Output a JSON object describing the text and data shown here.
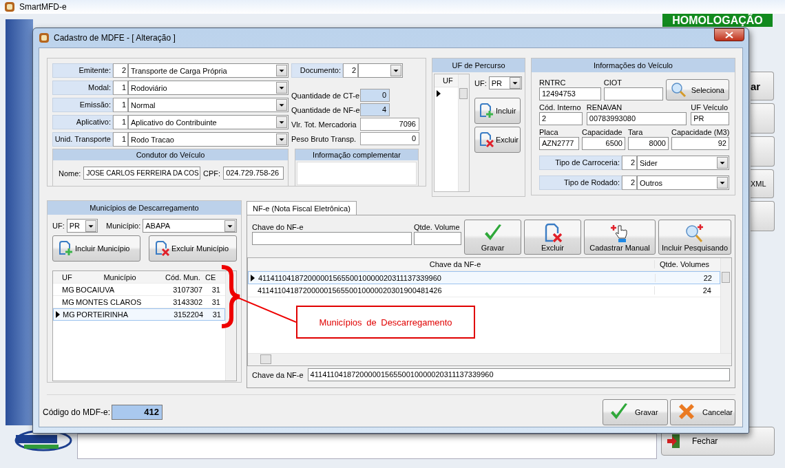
{
  "app": {
    "title": "SmartMFD-e",
    "banner": "HOMOLOGAÇÃO",
    "side_buttons": [
      {
        "label": "ar",
        "kind": "bold"
      },
      {
        "label": "XML",
        "kind": "plain"
      }
    ],
    "close_button": "Fechar"
  },
  "dialog": {
    "title": "Cadastro de MDFE - [ Alteração ]"
  },
  "general": {
    "fields": [
      {
        "label": "Emitente:",
        "code": "2",
        "value": "Transporte de Carga Própria"
      },
      {
        "label": "Modal:",
        "code": "1",
        "value": "Rodoviário"
      },
      {
        "label": "Emissão:",
        "code": "1",
        "value": "Normal"
      },
      {
        "label": "Aplicativo:",
        "code": "1",
        "value": "Aplicativo do Contribuinte"
      },
      {
        "label": "Unid. Transporte",
        "code": "1",
        "value": "Rodo Tracao"
      }
    ],
    "documento": {
      "label": "Documento:",
      "code": "2"
    },
    "totals": [
      {
        "label": "Quantidade de CT-e",
        "value": "0",
        "readonly": true
      },
      {
        "label": "Quantidade de NF-e",
        "value": "4",
        "readonly": true
      },
      {
        "label": "Vlr. Tot. Mercadoria",
        "value": "7096",
        "readonly": false
      },
      {
        "label": "Peso Bruto Transp.",
        "value": "0",
        "readonly": false
      }
    ]
  },
  "condutor": {
    "title": "Condutor do Veículo",
    "name_label": "Nome:",
    "name": "JOSE CARLOS FERREIRA DA COS",
    "cpf_label": "CPF:",
    "cpf": "024.729.758-26"
  },
  "info_complementar": {
    "title": "Informação complementar"
  },
  "uf_percurso": {
    "title": "UF de Percurso",
    "column": "UF",
    "uf_label": "UF:",
    "uf": "PR",
    "buttons": [
      {
        "label": "Incluir",
        "kind": "add"
      },
      {
        "label": "Excluir",
        "kind": "remove"
      }
    ]
  },
  "veiculo": {
    "title": "Informações do Veículo",
    "select_button": "Seleciona",
    "fields": [
      {
        "label": "RNTRC",
        "value": "12494753",
        "kind": "text"
      },
      {
        "label": "CIOT",
        "kind": "text"
      },
      {
        "label": "Cód. Interno",
        "value": "2",
        "kind": "text"
      },
      {
        "label": "RENAVAN",
        "value": "00783993080",
        "kind": "text"
      },
      {
        "label": "UF Veículo",
        "value": "PR",
        "kind": "text"
      },
      {
        "label": "Placa",
        "value": "AZN2777",
        "kind": "text"
      },
      {
        "label": "Capacidade",
        "value": "6500",
        "kind": "number"
      },
      {
        "label": "Tara",
        "value": "8000",
        "kind": "number"
      },
      {
        "label": "Capacidade (M3)",
        "value": "92",
        "kind": "number"
      }
    ],
    "combos": [
      {
        "label": "Tipo de Carroceria:",
        "code": "2",
        "value": "Sider"
      },
      {
        "label": "Tipo de Rodado:",
        "code": "2",
        "value": "Outros"
      }
    ]
  },
  "municipios": {
    "title": "Municípios de Descarregamento",
    "uf_label": "UF:",
    "uf": "PR",
    "municipio_label": "Município:",
    "municipio": "ABAPA",
    "buttons": [
      {
        "label": "Incluir Município",
        "kind": "add"
      },
      {
        "label": "Excluir Município",
        "kind": "remove"
      }
    ],
    "columns": [
      "UF",
      "Município",
      "Cód. Mun.",
      "CE"
    ],
    "rows": [
      {
        "uf": "MG",
        "municipio": "BOCAIUVA",
        "codigo": "3107307",
        "ce": "31",
        "selected": false
      },
      {
        "uf": "MG",
        "municipio": "MONTES CLAROS",
        "codigo": "3143302",
        "ce": "31",
        "selected": false
      },
      {
        "uf": "MG",
        "municipio": "PORTEIRINHA",
        "codigo": "3152204",
        "ce": "31",
        "selected": true
      }
    ]
  },
  "nfe": {
    "tabs": [
      {
        "label": "NF-e (Nota Fiscal Eletrônica)",
        "selected": true
      }
    ],
    "chave_label": "Chave do NF-e",
    "volume_label": "Qtde. Volume",
    "buttons": [
      {
        "label": "Gravar",
        "kind": "check"
      },
      {
        "label": "Excluir",
        "kind": "remove"
      },
      {
        "label": "Cadastrar Manual",
        "kind": "hand"
      },
      {
        "label": "Incluir Pesquisando",
        "kind": "search"
      }
    ],
    "columns": [
      "Chave da NF-e",
      "Qtde. Volumes"
    ],
    "rows": [
      {
        "chave": "41141104187200000156550010000020311137339960",
        "volumes": "22",
        "selected": true
      },
      {
        "chave": "41141104187200000156550010000020301900481426",
        "volumes": "24",
        "selected": false
      }
    ],
    "detail_label": "Chave da NF-e",
    "detail_value": "41141104187200000156550010000020311137339960"
  },
  "footer": {
    "codigo_label": "Código do MDF-e:",
    "codigo": "412",
    "buttons": [
      {
        "label": "Gravar",
        "kind": "check"
      },
      {
        "label": "Cancelar",
        "kind": "cancel"
      }
    ]
  },
  "annotation": {
    "text": "Municípios de Descarregamento"
  }
}
